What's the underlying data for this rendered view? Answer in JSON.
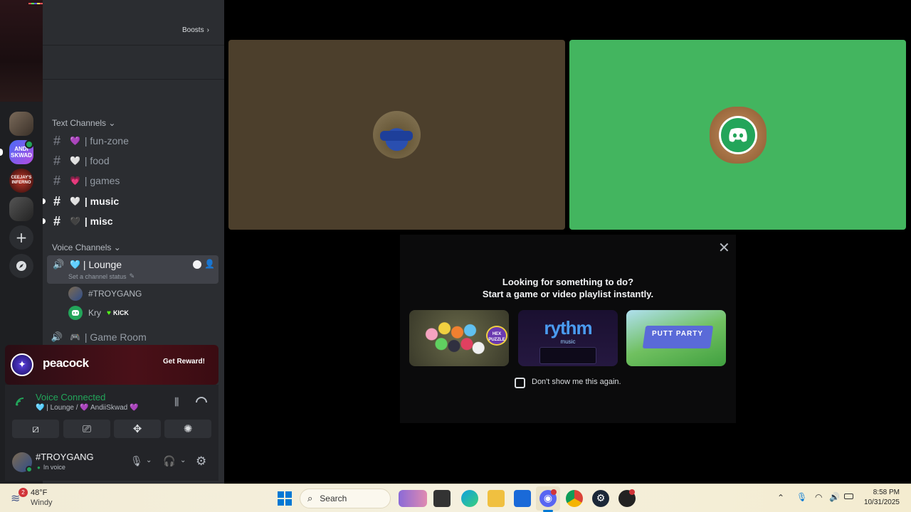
{
  "window": {
    "boosts_label": "Boosts"
  },
  "sidebar": {
    "text_category": "Text Channels",
    "text_channels": [
      {
        "name": "fun-zone",
        "emoji": "💜"
      },
      {
        "name": "food",
        "emoji": "🤍"
      },
      {
        "name": "games",
        "emoji": "💗"
      },
      {
        "name": "music",
        "emoji": "🤍"
      },
      {
        "name": "misc",
        "emoji": "🖤"
      }
    ],
    "voice_category": "Voice Channels",
    "voice_channels": [
      {
        "name": "Lounge",
        "emoji": "🩵",
        "status_placeholder": "Set a channel status"
      },
      {
        "name": "Game Room",
        "emoji": "🎮"
      }
    ],
    "lounge_users": [
      {
        "name": "#TROYGANG"
      },
      {
        "name": "Kry",
        "badge": "KICK"
      }
    ]
  },
  "servers": [
    {
      "name": "server-1",
      "label": ""
    },
    {
      "name": "andii-skwad",
      "label": "ANDI SKWAD"
    },
    {
      "name": "ceejays-inferno",
      "label": "CEEJAY'S INFERNO"
    },
    {
      "name": "server-car",
      "label": ""
    }
  ],
  "ad": {
    "brand": "peacock",
    "cta": "Get Reward!"
  },
  "voice": {
    "status": "Voice Connected",
    "location": "🩵 | Lounge / 💜 AndiiSkwad 💜",
    "user": "#TROYGANG",
    "user_status": "In voice"
  },
  "modal": {
    "line1": "Looking for something to do?",
    "line2": "Start a game or video playlist instantly.",
    "activities": [
      {
        "name": "Hex Puzzle",
        "label": "HEX PUZZLE"
      },
      {
        "name": "Rythm",
        "label": "rythm",
        "sublabel": "music"
      },
      {
        "name": "Putt Party",
        "label": "PUTT PARTY"
      }
    ],
    "checkbox_label": "Don't show me this again."
  },
  "taskbar": {
    "weather_temp": "48°F",
    "weather_desc": "Windy",
    "weather_badge": "2",
    "search_label": "Search",
    "time": "8:58 PM",
    "date": "10/31/2025"
  },
  "colors": {
    "green_tile": "#43b55f",
    "brown_tile": "#4c3f2c",
    "discord_green": "#23a55a",
    "blurple": "#5865f2"
  }
}
